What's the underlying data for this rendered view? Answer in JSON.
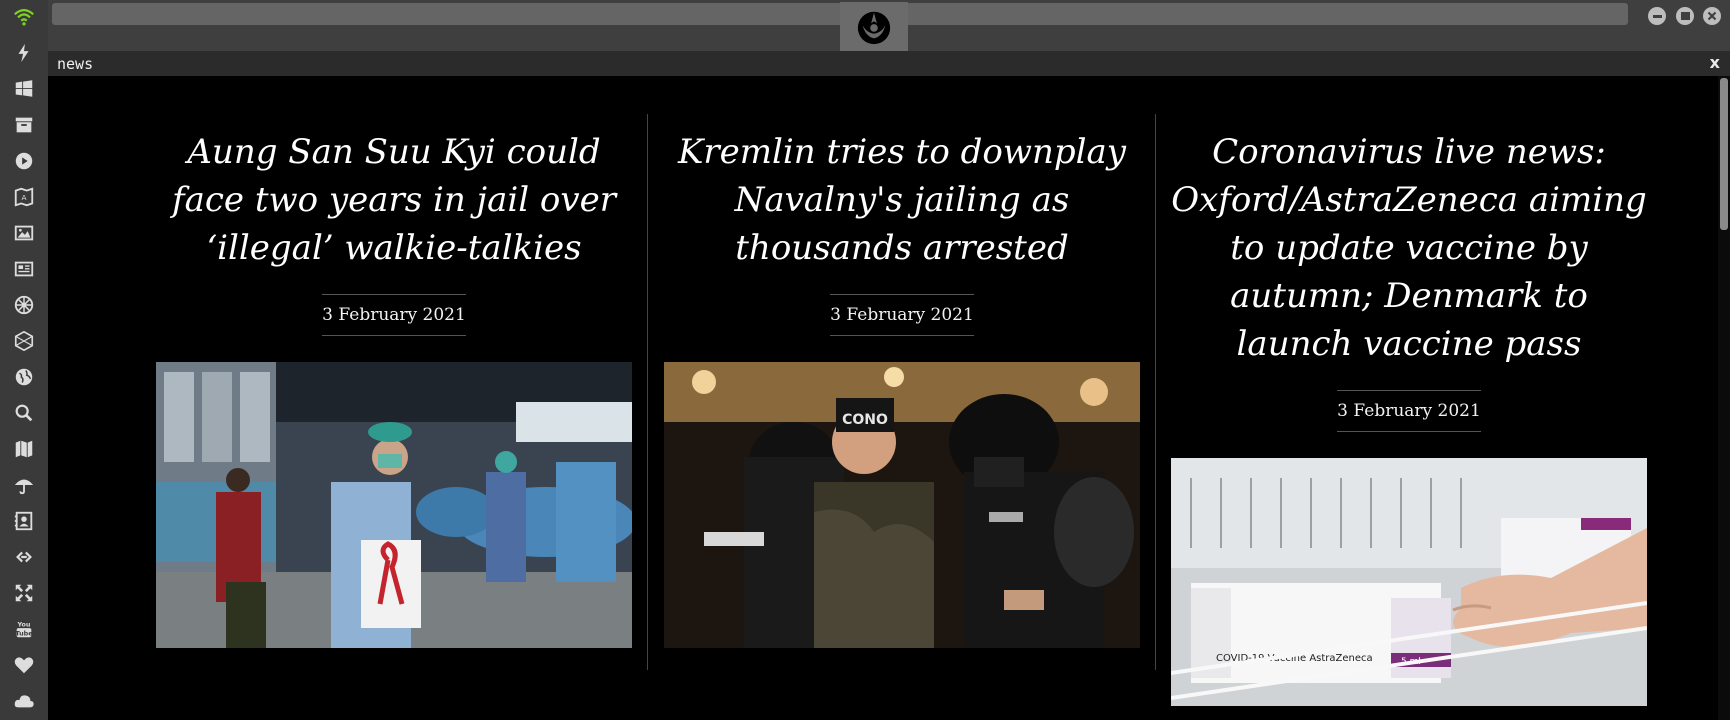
{
  "panel": {
    "title": "news",
    "close_label": "x"
  },
  "window_controls": [
    "minimize-icon",
    "maximize-icon",
    "close-icon"
  ],
  "dock_icons": [
    "wifi-icon",
    "lightning-icon",
    "windows-icon",
    "archive-icon",
    "play-icon",
    "map-book-icon",
    "image-icon",
    "newspaper-icon",
    "empire-icon",
    "hexagon-icon",
    "globe-icon",
    "search-icon",
    "map-icon",
    "umbrella-icon",
    "contact-icon",
    "link-icon",
    "expand-icon",
    "youtube-icon",
    "heart-icon",
    "cloud-icon"
  ],
  "articles": [
    {
      "headline": "Aung San Suu Kyi could face two years in jail over ‘illegal’ walkie-talkies",
      "date": "3 February 2021",
      "image": "doctor-holding-red-ribbon-sign"
    },
    {
      "headline": "Kremlin tries to downplay Navalny's jailing as thousands arrested",
      "date": "3 February 2021",
      "image": "riot-police-detaining-protester"
    },
    {
      "headline": "Coronavirus live news: Oxford/AstraZeneca aiming to update vaccine by autumn; Denmark to launch vaccine pass",
      "date": "3 February 2021",
      "image": "hand-taking-covid-19-vaccine-astrazeneca-box"
    }
  ],
  "vaccine_box": {
    "label": "COVID-19 Vaccine AstraZeneca",
    "dose": "5 ml"
  },
  "colors": {
    "dock_bg": "#3a3a3a",
    "topbar_bg": "#3f3f3f",
    "content_bg": "#000000",
    "wifi": "#7ed321"
  }
}
